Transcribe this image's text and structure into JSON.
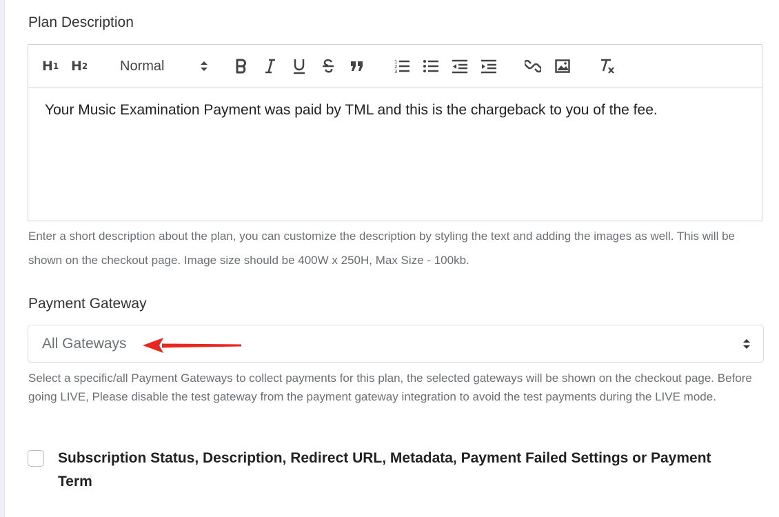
{
  "plan_description": {
    "label": "Plan Description",
    "toolbar": {
      "h1_label": "H",
      "h1_sub": "1",
      "h2_label": "H",
      "h2_sub": "2",
      "size_value": "Normal",
      "icons": [
        "bold-icon",
        "italic-icon",
        "underline-icon",
        "strikethrough-icon",
        "quote-icon",
        "ordered-list-icon",
        "bullet-list-icon",
        "outdent-icon",
        "indent-icon",
        "link-icon",
        "image-icon",
        "clear-format-icon"
      ]
    },
    "content": "Your Music Examination Payment was paid by TML and this is the chargeback to you of the fee.",
    "help": "Enter a short description about the plan, you can customize the description by styling the text and adding the images as well. This will be shown on the checkout page. Image size should be 400W x 250H, Max Size - 100kb."
  },
  "payment_gateway": {
    "label": "Payment Gateway",
    "selected": "All Gateways",
    "help": "Select a specific/all Payment Gateways to collect payments for this plan, the selected gateways will be shown on the checkout page. Before going LIVE, Please disable the test gateway from the payment gateway integration to avoid the test payments during the LIVE mode.",
    "annotation_color": "#e8281e"
  },
  "subscription_option": {
    "label": "Subscription Status, Description, Redirect URL, Metadata, Payment Failed Settings or Payment Term",
    "checked": false
  }
}
